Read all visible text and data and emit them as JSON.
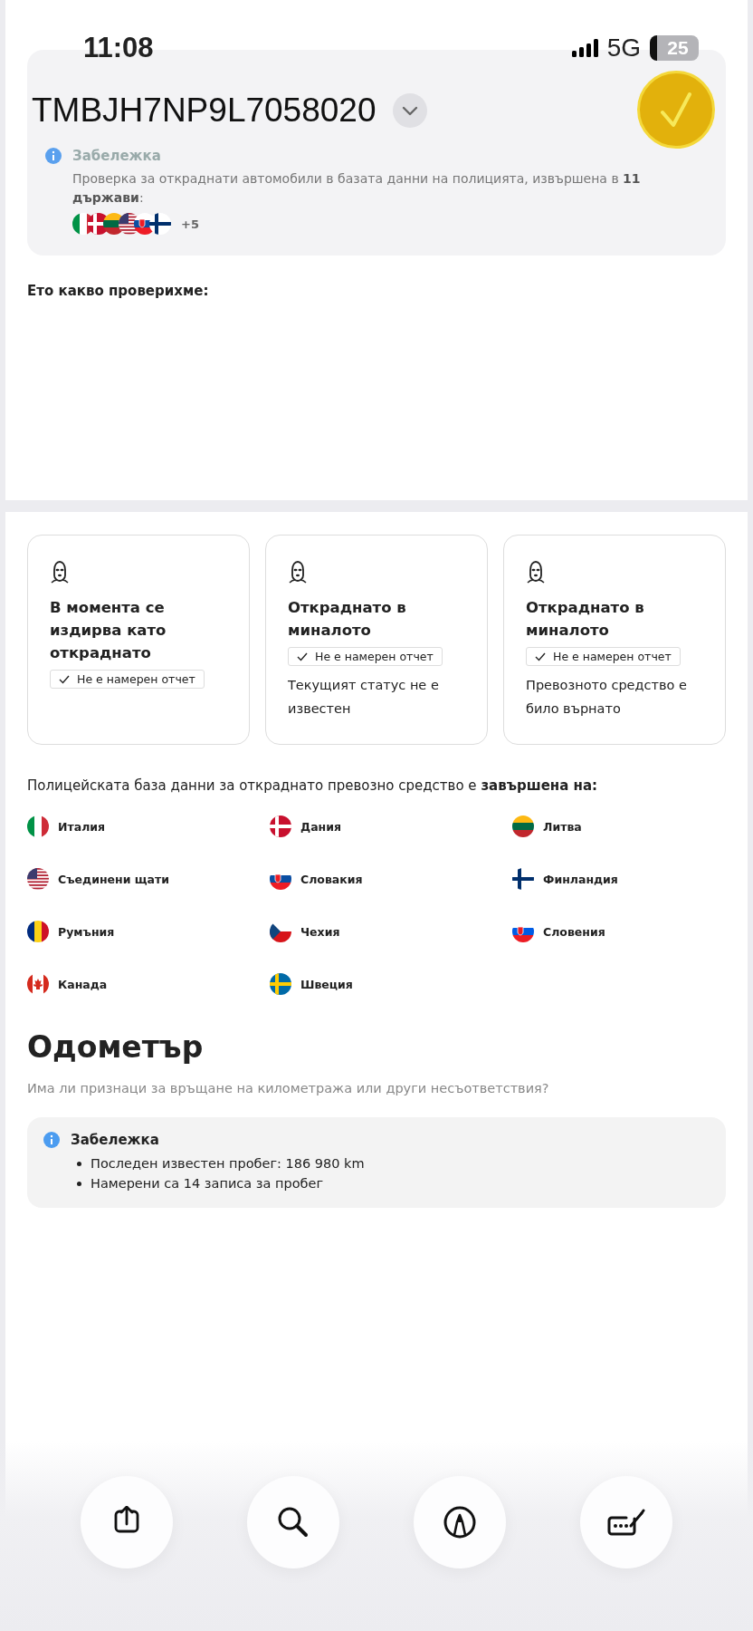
{
  "status_bar": {
    "time": "11:08",
    "network": "5G",
    "battery": "25"
  },
  "header": {
    "vin": "TMBJH7NP9L7058020",
    "verified": true
  },
  "note": {
    "title": "Забележка",
    "text": "Проверка за откраднати автомобили в базата данни на полицията, извършена в **11 държави**:",
    "flags": [
      {
        "kind": "italy"
      },
      {
        "kind": "denmark"
      },
      {
        "kind": "lithuania"
      },
      {
        "kind": "usa"
      },
      {
        "kind": "slovakia"
      },
      {
        "kind": "finland"
      }
    ],
    "more": "+5"
  },
  "checked_heading": "Ето какво проверихме:",
  "checks": [
    {
      "title": "В момента се издирва като откраднато",
      "badge": "Не е намерен отчет"
    },
    {
      "title": "Откраднато в миналото",
      "badge": "Не е намерен отчет",
      "text": "Текущият статус не е известен"
    },
    {
      "title": "Откраднато в миналото",
      "badge": "Не е намерен отчет",
      "text": "Превозното средство е било върнато"
    }
  ],
  "countries_intro": "Полицейската база данни за откраднато превозно средство е **завършена на:**",
  "countries": [
    {
      "name": "Италия",
      "kind": "italy"
    },
    {
      "name": "Дания",
      "kind": "denmark"
    },
    {
      "name": "Литва",
      "kind": "lithuania"
    },
    {
      "name": "Съединени щати",
      "kind": "usa"
    },
    {
      "name": "Словакия",
      "kind": "slovakia"
    },
    {
      "name": "Финландия",
      "kind": "finland"
    },
    {
      "name": "Румъния",
      "kind": "romania"
    },
    {
      "name": "Чехия",
      "kind": "czechia"
    },
    {
      "name": "Словения",
      "kind": "slovenia"
    },
    {
      "name": "Канада",
      "kind": "canada"
    },
    {
      "name": "Швеция",
      "kind": "sweden"
    }
  ],
  "odometer": {
    "title": "Одометър",
    "subtitle": "Има ли признаци за връщане на километража или други несъответствия?",
    "note_title": "Забележка",
    "items": [
      "Последен известен пробег: 186 980 km",
      "Намерени са 14 записа за пробег"
    ]
  },
  "toolbar": [
    {
      "kind": "share"
    },
    {
      "kind": "search"
    },
    {
      "kind": "markup"
    },
    {
      "kind": "autofill"
    }
  ]
}
